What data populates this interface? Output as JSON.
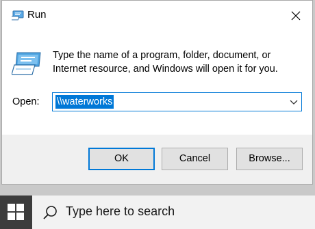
{
  "window": {
    "title": "Run",
    "title_icon": "run-icon",
    "close_icon": "close-icon"
  },
  "content": {
    "icon": "run-large-icon",
    "description_line1": "Type the name of a program, folder, document, or",
    "description_line2": "Internet resource, and Windows will open it for you.",
    "open_label": "Open:",
    "open_value": "\\\\waterworks",
    "dropdown_icon": "chevron-down-icon"
  },
  "buttons": {
    "ok": "OK",
    "cancel": "Cancel",
    "browse": "Browse..."
  },
  "taskbar": {
    "start_icon": "windows-logo-icon",
    "search_icon": "search-icon",
    "search_placeholder": "Type here to search"
  },
  "colors": {
    "accent": "#0078d7",
    "dialog_bg": "#f0f0f0",
    "taskbar_start": "#3c3c3c"
  }
}
